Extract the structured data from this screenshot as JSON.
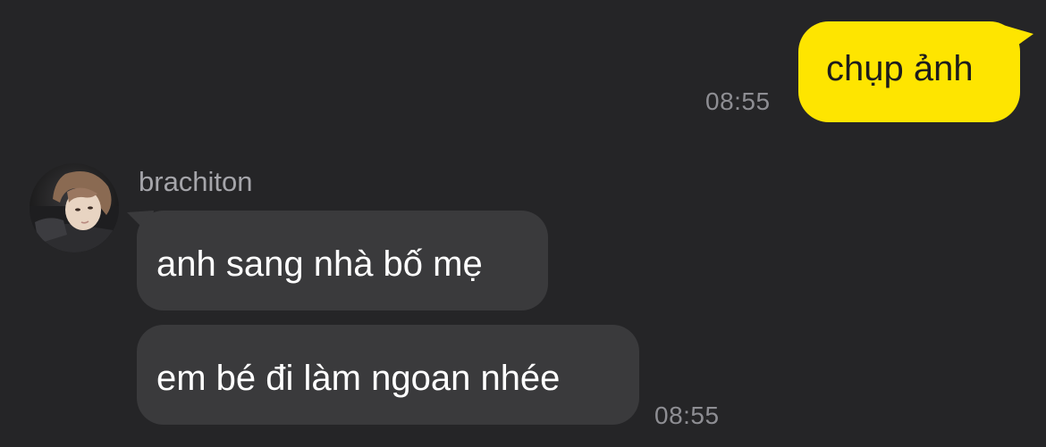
{
  "conversation": {
    "outgoing": [
      {
        "text": "chụp ảnh",
        "time": "08:55"
      }
    ],
    "incoming": {
      "sender": "brachiton",
      "messages": [
        {
          "text": "anh sang nhà bố mẹ"
        },
        {
          "text": "em bé đi làm ngoan nhée",
          "time": "08:55"
        }
      ]
    }
  },
  "colors": {
    "background": "#252527",
    "outgoing_bubble": "#fee500",
    "incoming_bubble": "#3a3a3c",
    "timestamp": "#8e8e93"
  },
  "icons": {
    "avatar": "profile-photo"
  }
}
